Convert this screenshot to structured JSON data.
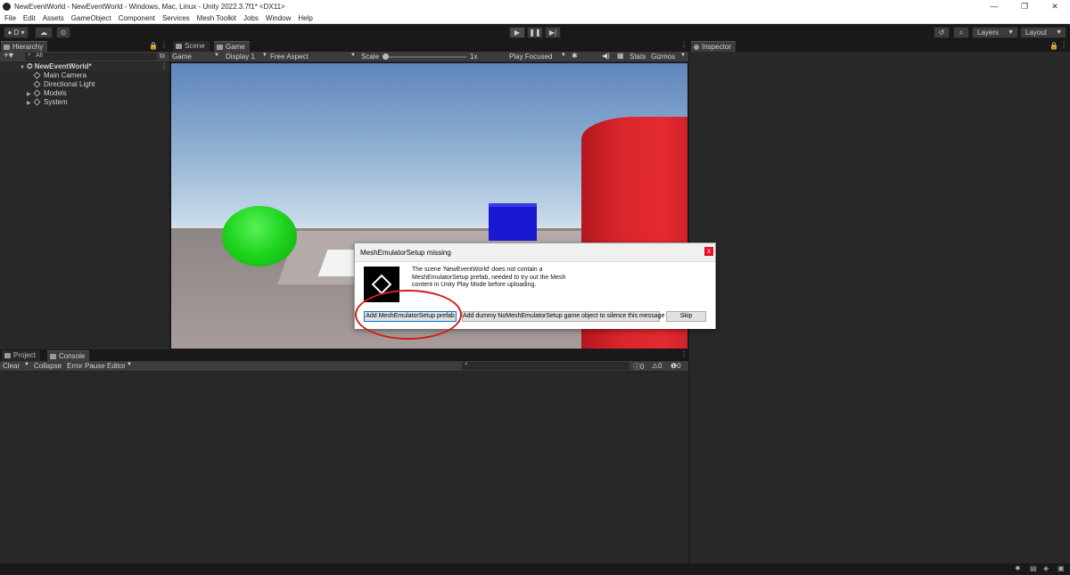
{
  "window": {
    "title": "NewEventWorld - NewEventWorld - Windows, Mac, Linux - Unity 2022.3.7f1* <DX11>",
    "controls": [
      "—",
      "❐",
      "✕"
    ]
  },
  "menu": [
    "File",
    "Edit",
    "Assets",
    "GameObject",
    "Component",
    "Services",
    "Mesh Toolkit",
    "Jobs",
    "Window",
    "Help"
  ],
  "toolbar": {
    "account": "D",
    "layers": "Layers",
    "layout": "Layout"
  },
  "hierarchy": {
    "tab": "Hierarchy",
    "search_placeholder": "All",
    "scene": "NewEventWorld*",
    "items": [
      "Main Camera",
      "Directional Light",
      "Models",
      "System"
    ]
  },
  "center": {
    "tabs": {
      "scene": "Scene",
      "game": "Game"
    },
    "game_dropdown": "Game",
    "display": "Display 1",
    "aspect": "Free Aspect",
    "scale_label": "Scale",
    "scale_value": "1x",
    "play_focused": "Play Focused",
    "stats": "Stats",
    "gizmos": "Gizmos"
  },
  "inspector": {
    "tab": "Inspector"
  },
  "bottom": {
    "tabs": {
      "project": "Project",
      "console": "Console"
    },
    "clear": "Clear",
    "collapse": "Collapse",
    "error_pause": "Error Pause",
    "editor": "Editor",
    "counts": [
      "0",
      "0",
      "0"
    ]
  },
  "dialog": {
    "title": "MeshEmulatorSetup missing",
    "close": "x",
    "message": "The scene 'NewEventWorld' does not contain a MeshEmulatorSetup prefab, needed to try out the Mesh content in Unity Play Mode before uploading.",
    "buttons": {
      "add_prefab": "Add MeshEmulatorSetup prefab",
      "add_dummy": "Add dummy NoMeshEmulatorSetup game object to silence this message",
      "skip": "Skip"
    }
  },
  "colors": {
    "accent_circle": "#d21c1c",
    "sphere": "#1ed41e",
    "cube": "#1a18d0",
    "cylinder": "#e42a30"
  }
}
